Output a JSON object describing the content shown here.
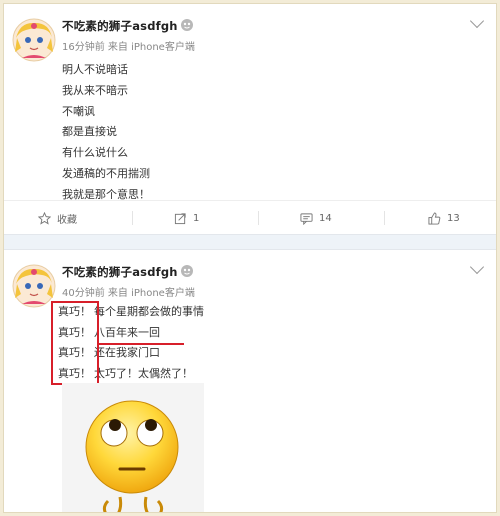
{
  "posts": [
    {
      "username": "不吃素的狮子asdfgh",
      "meta": "16分钟前 来自 iPhone客户端",
      "lines": [
        "明人不说暗话",
        "我从来不暗示",
        "不嘲讽",
        "都是直接说",
        "有什么说什么",
        "发通稿的不用揣测",
        "我就是那个意思！"
      ],
      "actions": {
        "favorite_label": "收藏",
        "repost_count": "1",
        "comment_count": "14",
        "like_count": "13"
      }
    },
    {
      "username": "不吃素的狮子asdfgh",
      "meta": "40分钟前 来自 iPhone客户端",
      "rows": [
        {
          "a": "真巧！",
          "b": "每个星期都会做的事情"
        },
        {
          "a": "真巧！",
          "b": "八百年来一回"
        },
        {
          "a": "真巧！",
          "b": "还在我家门口"
        },
        {
          "a": "真巧！",
          "b": "太巧了！太偶然了！"
        }
      ]
    }
  ],
  "colors": {
    "highlight_red": "#d71f2a",
    "separator": "#eef3f8",
    "page_bg": "#f3ecd7"
  },
  "icons": [
    "avatar",
    "vip-badge-icon",
    "chevron-down-icon",
    "star-icon",
    "repost-icon",
    "comment-icon",
    "thumbs-up-icon",
    "emoji-eyes-up"
  ]
}
